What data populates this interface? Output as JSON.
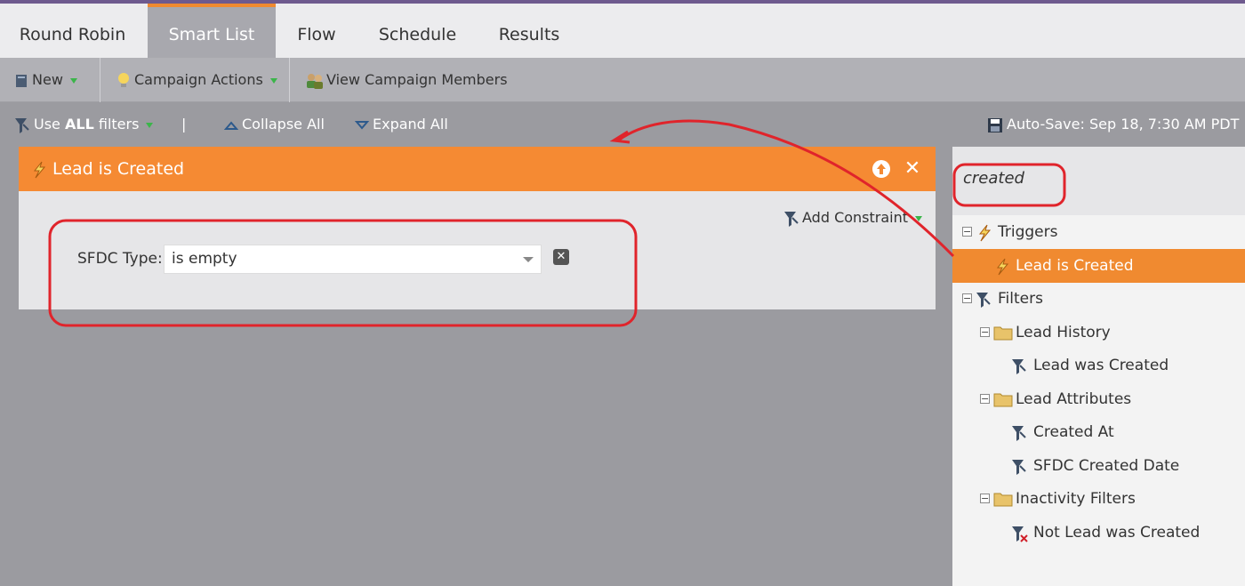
{
  "tabs": [
    "Round Robin",
    "Smart List",
    "Flow",
    "Schedule",
    "Results"
  ],
  "active_tab": "Smart List",
  "toolbar": {
    "new_label": "New",
    "campaign_actions_label": "Campaign Actions",
    "view_members_label": "View Campaign Members"
  },
  "subbar": {
    "use_prefix": "Use",
    "use_all": "ALL",
    "use_suffix": "filters",
    "separator": "|",
    "collapse_label": "Collapse All",
    "expand_label": "Expand All",
    "autosave": "Auto-Save: Sep 18, 7:30 AM PDT"
  },
  "trigger_card": {
    "title": "Lead is Created",
    "add_constraint": "Add Constraint",
    "constraint_label": "SFDC Type:",
    "constraint_value": "is empty"
  },
  "search": {
    "value": "created"
  },
  "tree": {
    "triggers": "Triggers",
    "lead_is_created": "Lead is Created",
    "filters": "Filters",
    "lead_history": "Lead History",
    "lead_was_created": "Lead was Created",
    "lead_attributes": "Lead Attributes",
    "created_at": "Created At",
    "sfdc_created_date": "SFDC Created Date",
    "inactivity_filters": "Inactivity Filters",
    "not_lead_was_created": "Not Lead was Created"
  },
  "colors": {
    "accent_orange": "#f58a33",
    "annotation_red": "#e0242b",
    "tab_top": "#6e5a8e"
  }
}
